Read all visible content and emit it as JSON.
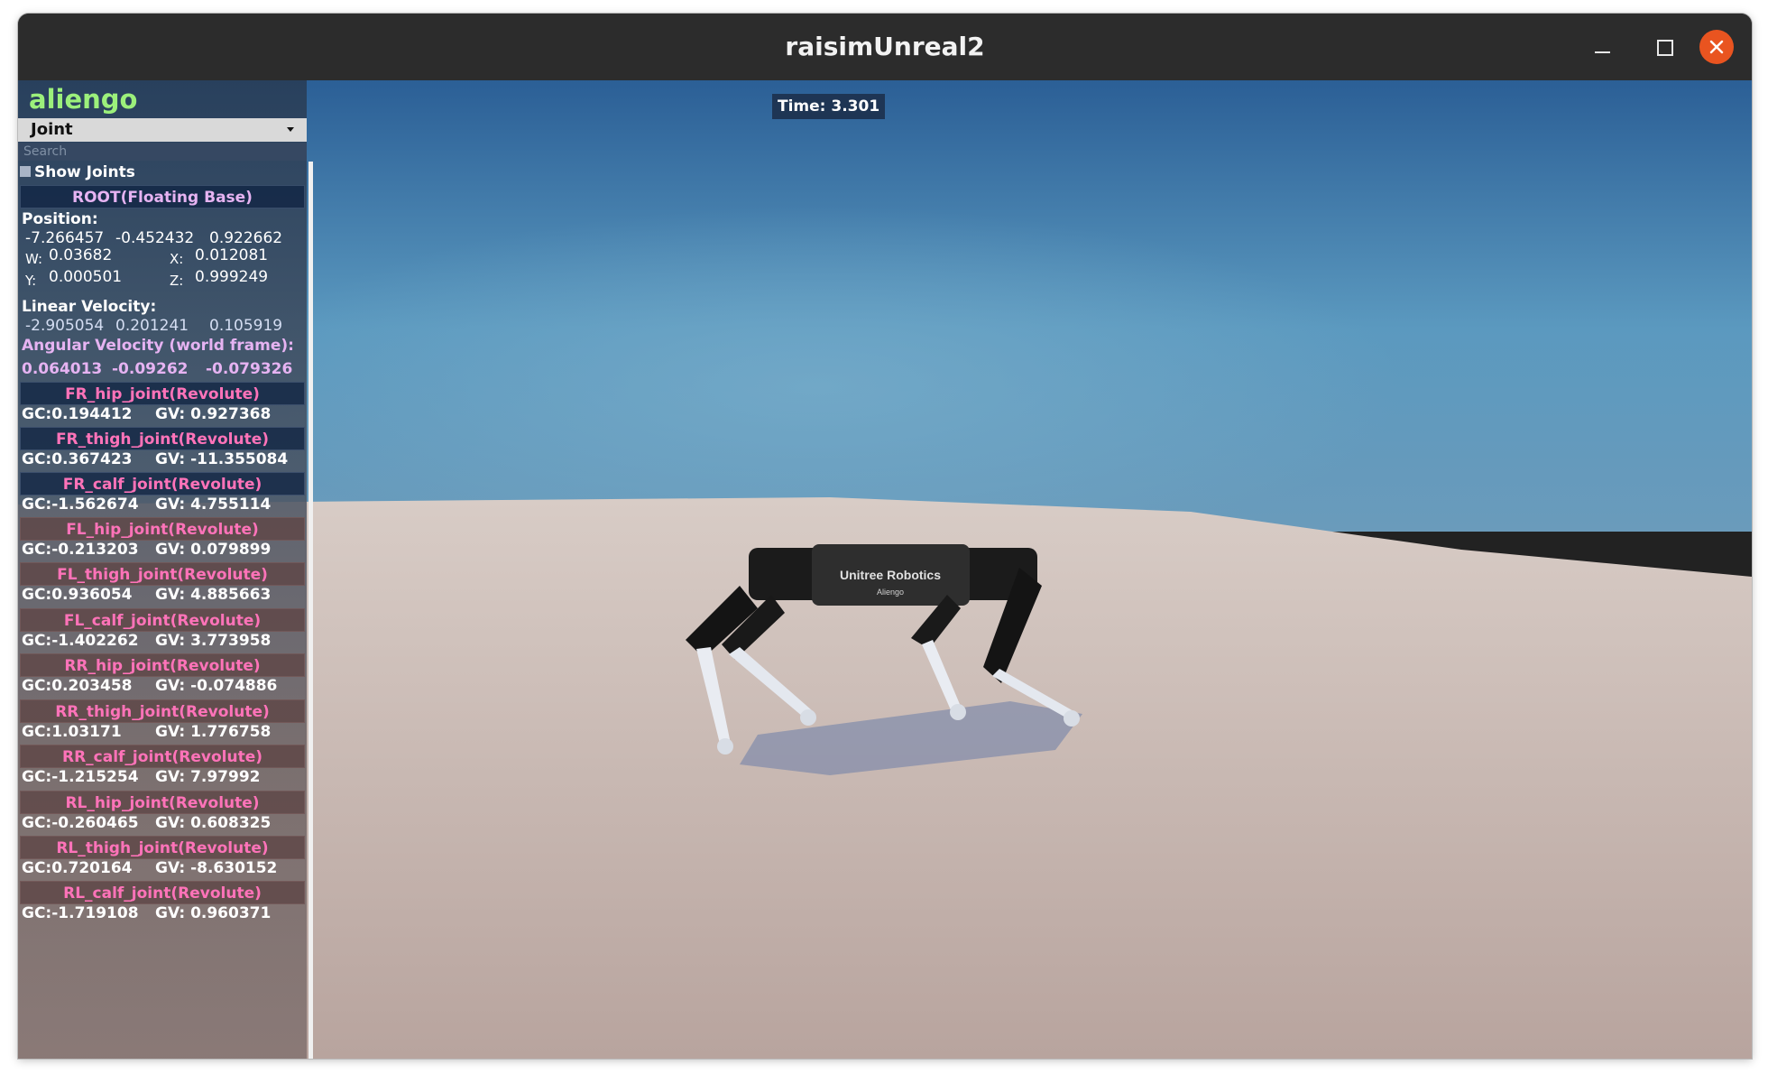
{
  "window": {
    "title": "raisimUnreal2",
    "close_color": "#e95420"
  },
  "viewport": {
    "time_label": "Time: 3.301",
    "sky_color": "#4a86b0",
    "ground_color": "#cbbcb6",
    "robot_body_text": "Unitree Robotics",
    "robot_model_text": "Aliengo"
  },
  "panel": {
    "robot_name": "aliengo",
    "view_select": "Joint",
    "search_placeholder": "Search",
    "show_joints_label": "Show Joints",
    "root_header": "ROOT(Floating Base)",
    "position_label": "Position:",
    "position": [
      "-7.266457",
      "-0.452432",
      "0.922662"
    ],
    "quat": {
      "w_label": "W:",
      "w": "0.03682",
      "x_label": "X:",
      "x": "0.012081",
      "y_label": "Y:",
      "y": "0.000501",
      "z_label": "Z:",
      "z": "0.999249"
    },
    "linvel_label": "Linear Velocity:",
    "linvel": [
      "-2.905054",
      "0.201241",
      "0.105919"
    ],
    "angvel_label": "Angular Velocity (world frame):",
    "angvel": [
      "0.064013",
      "-0.09262",
      "-0.079326"
    ],
    "joints": [
      {
        "name": "FR_hip_joint(Revolute)",
        "gc": "GC:0.194412",
        "gv": "GV: 0.927368"
      },
      {
        "name": "FR_thigh_joint(Revolute)",
        "gc": "GC:0.367423",
        "gv": "GV: -11.355084"
      },
      {
        "name": "FR_calf_joint(Revolute)",
        "gc": "GC:-1.562674",
        "gv": "GV: 4.755114"
      },
      {
        "name": "FL_hip_joint(Revolute)",
        "gc": "GC:-0.213203",
        "gv": "GV: 0.079899"
      },
      {
        "name": "FL_thigh_joint(Revolute)",
        "gc": "GC:0.936054",
        "gv": "GV: 4.885663"
      },
      {
        "name": "FL_calf_joint(Revolute)",
        "gc": "GC:-1.402262",
        "gv": "GV: 3.773958"
      },
      {
        "name": "RR_hip_joint(Revolute)",
        "gc": "GC:0.203458",
        "gv": "GV: -0.074886"
      },
      {
        "name": "RR_thigh_joint(Revolute)",
        "gc": "GC:1.03171",
        "gv": "GV: 1.776758"
      },
      {
        "name": "RR_calf_joint(Revolute)",
        "gc": "GC:-1.215254",
        "gv": "GV: 7.97992"
      },
      {
        "name": "RL_hip_joint(Revolute)",
        "gc": "GC:-0.260465",
        "gv": "GV: 0.608325"
      },
      {
        "name": "RL_thigh_joint(Revolute)",
        "gc": "GC:0.720164",
        "gv": "GV: -8.630152"
      },
      {
        "name": "RL_calf_joint(Revolute)",
        "gc": "GC:-1.719108",
        "gv": "GV: 0.960371"
      }
    ]
  }
}
